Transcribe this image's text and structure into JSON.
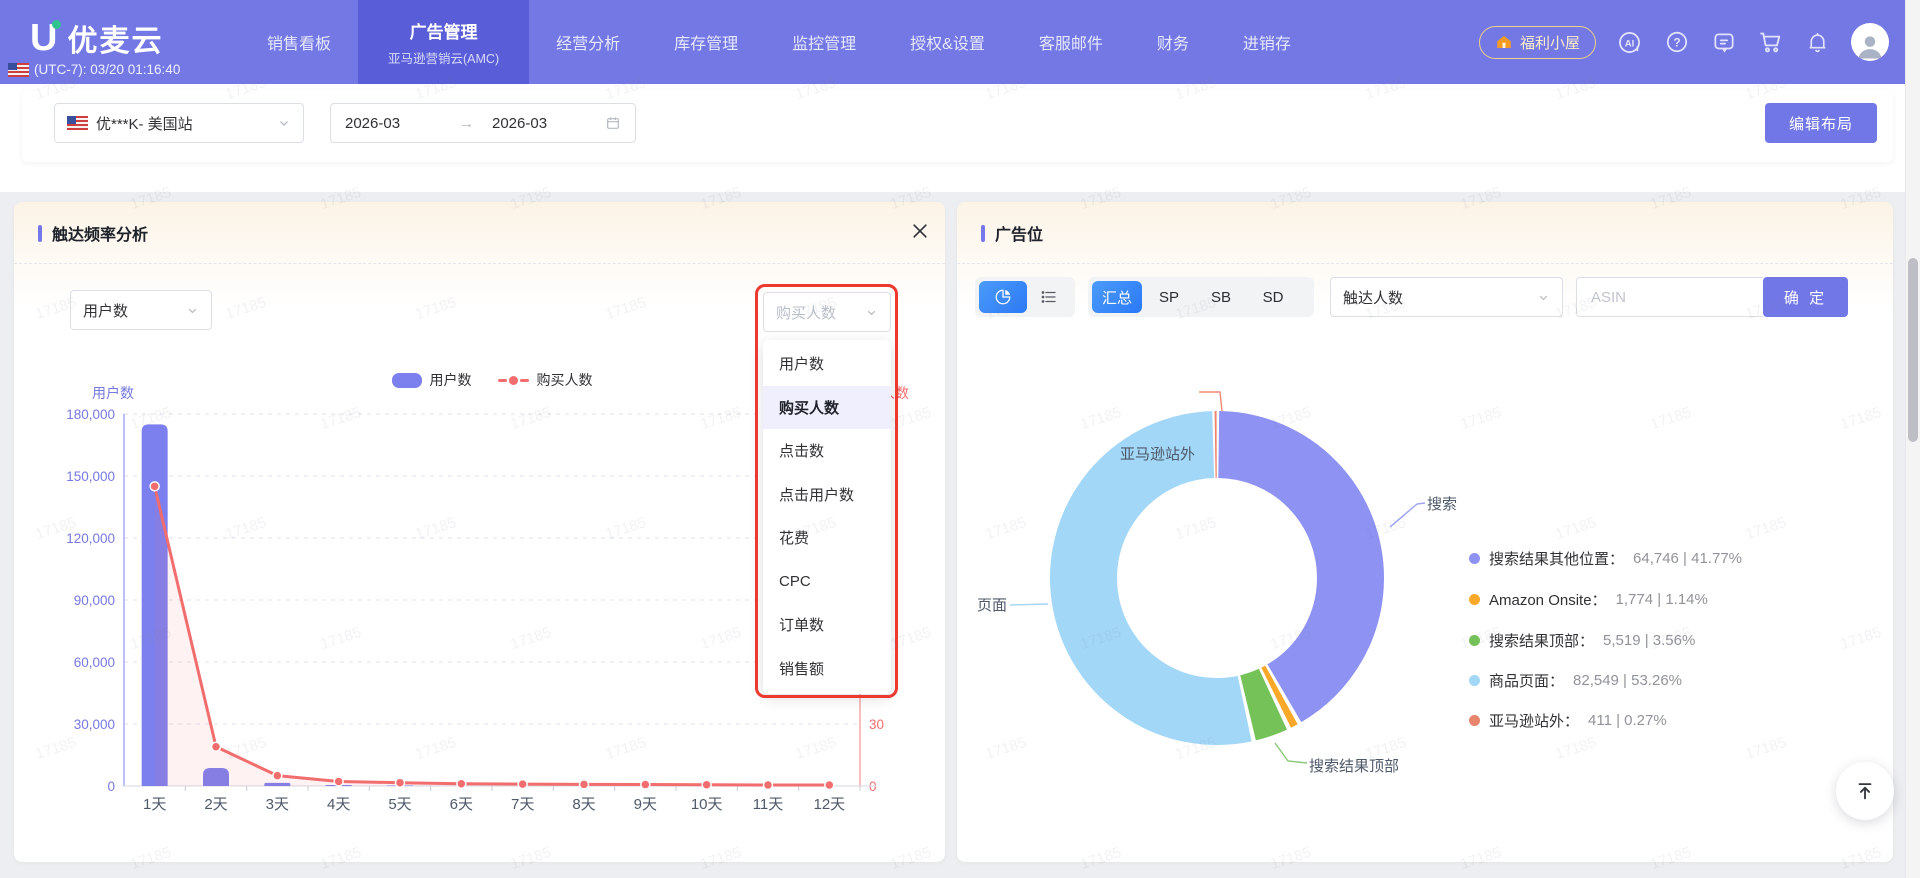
{
  "page": {
    "watermark": "17185"
  },
  "navbar": {
    "brand": "优麦云",
    "brand_initial": "U",
    "timezone": "(UTC-7): 03/20 01:16:40",
    "items": [
      {
        "label": "销售看板"
      },
      {
        "label": "广告管理",
        "sublabel": "亚马逊营销云(AMC)",
        "active": true
      },
      {
        "label": "经营分析"
      },
      {
        "label": "库存管理"
      },
      {
        "label": "监控管理"
      },
      {
        "label": "授权&设置"
      },
      {
        "label": "客服邮件"
      },
      {
        "label": "财务"
      },
      {
        "label": "进销存"
      }
    ],
    "welfare_badge": "福利小屋"
  },
  "filter_bar": {
    "account": "优***K- 美国站",
    "date_start": "2026-03",
    "date_end": "2026-03",
    "edit_layout": "编辑布局"
  },
  "reach_panel": {
    "title": "触达频率分析",
    "left_select_value": "用户数",
    "highlight_select_value": "购买人数",
    "dropdown_options": [
      "用户数",
      "购买人数",
      "点击数",
      "点击用户数",
      "花费",
      "CPC",
      "订单数",
      "销售额"
    ],
    "dropdown_selected_index": 1
  },
  "placement_panel": {
    "title": "广告位",
    "view_tabs": [
      "汇总",
      "SP",
      "SB",
      "SD"
    ],
    "active_view_tab": "汇总",
    "metric_select_value": "触达人数",
    "asin_placeholder": "ASIN",
    "confirm_button": "确 定",
    "callouts": {
      "top": "亚马逊站外",
      "right": "搜索",
      "left": "页面",
      "bottom": "搜索结果顶部"
    },
    "legend": [
      {
        "label": "搜索结果其他位置",
        "value": "64,746",
        "pct": "41.77%",
        "color": "#8d92f3"
      },
      {
        "label": "Amazon Onsite",
        "value": "1,774",
        "pct": "1.14%",
        "color": "#f9a82a"
      },
      {
        "label": "搜索结果顶部",
        "value": "5,519",
        "pct": "3.56%",
        "color": "#74c258"
      },
      {
        "label": "商品页面",
        "value": "82,549",
        "pct": "53.26%",
        "color": "#a2d7f8"
      },
      {
        "label": "亚马逊站外",
        "value": "411",
        "pct": "0.27%",
        "color": "#e8856c"
      }
    ]
  },
  "chart_data": [
    {
      "type": "bar+line",
      "title": "触达频率分析",
      "categories": [
        "1天",
        "2天",
        "3天",
        "4天",
        "5天",
        "6天",
        "7天",
        "8天",
        "9天",
        "10天",
        "11天",
        "12天"
      ],
      "series": [
        {
          "name": "用户数",
          "type": "bar",
          "axis": "left",
          "color": "#7c80ee",
          "values": [
            175000,
            8700,
            1500,
            500,
            250,
            150,
            100,
            70,
            50,
            40,
            30,
            25
          ]
        },
        {
          "name": "购买人数",
          "type": "line",
          "axis": "right",
          "color": "#f26d6d",
          "values": [
            145,
            19,
            5,
            2.2,
            1.6,
            1.1,
            0.9,
            0.8,
            0.7,
            0.6,
            0.5,
            0.5
          ]
        }
      ],
      "left_axis": {
        "title": "用户数",
        "min": 0,
        "max": 180000,
        "step": 30000
      },
      "right_axis": {
        "title": "购买人数",
        "min": 0,
        "max": 180,
        "step": 30
      },
      "grid": "dashed horizontal",
      "legend_position": "top"
    },
    {
      "type": "pie",
      "title": "广告位",
      "donut": true,
      "slices": [
        {
          "label": "搜索结果其他位置",
          "value": 64746,
          "pct": 41.77,
          "color": "#8d92f3"
        },
        {
          "label": "Amazon Onsite",
          "value": 1774,
          "pct": 1.14,
          "color": "#f9a82a"
        },
        {
          "label": "搜索结果顶部",
          "value": 5519,
          "pct": 3.56,
          "color": "#74c258"
        },
        {
          "label": "商品页面",
          "value": 82549,
          "pct": 53.26,
          "color": "#a2d7f8"
        },
        {
          "label": "亚马逊站外",
          "value": 411,
          "pct": 0.27,
          "color": "#e8856c"
        }
      ],
      "legend_position": "right"
    }
  ]
}
